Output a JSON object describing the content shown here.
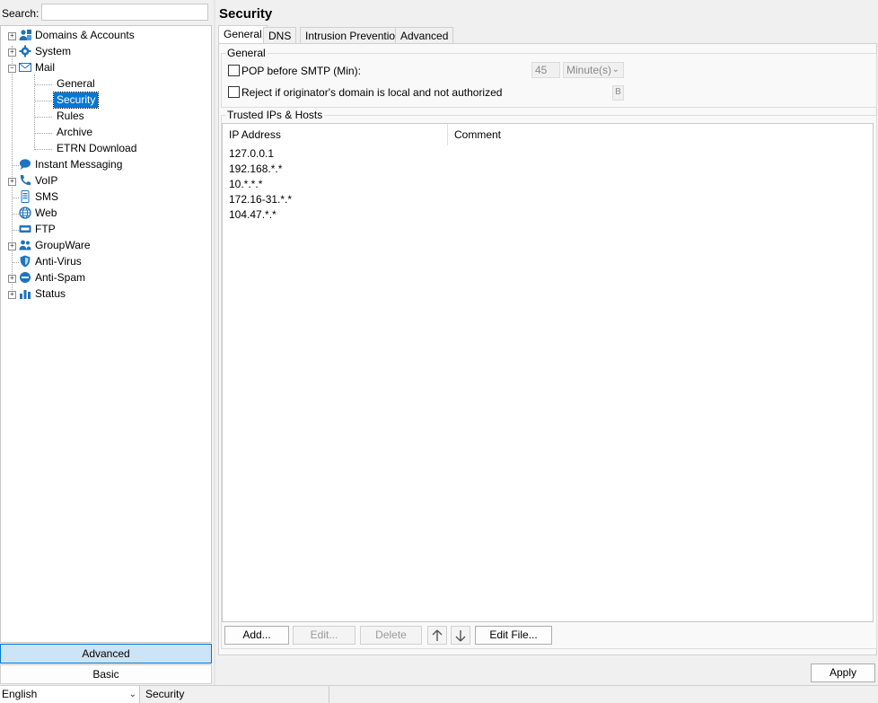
{
  "search": {
    "label": "Search:",
    "value": ""
  },
  "tree": {
    "items": [
      {
        "label": "Domains & Accounts",
        "icon": "users-icon"
      },
      {
        "label": "System",
        "icon": "gear-icon"
      },
      {
        "label": "Mail",
        "icon": "envelope-icon"
      },
      {
        "label": "General"
      },
      {
        "label": "Security"
      },
      {
        "label": "Rules"
      },
      {
        "label": "Archive"
      },
      {
        "label": "ETRN Download"
      },
      {
        "label": "Instant Messaging",
        "icon": "chat-bubble-icon"
      },
      {
        "label": "VoIP",
        "icon": "phone-icon"
      },
      {
        "label": "SMS",
        "icon": "sms-icon"
      },
      {
        "label": "Web",
        "icon": "globe-icon"
      },
      {
        "label": "FTP",
        "icon": "ftp-icon"
      },
      {
        "label": "GroupWare",
        "icon": "groupware-icon"
      },
      {
        "label": "Anti-Virus",
        "icon": "shield-icon"
      },
      {
        "label": "Anti-Spam",
        "icon": "no-entry-icon"
      },
      {
        "label": "Status",
        "icon": "bar-chart-icon"
      }
    ]
  },
  "mode_buttons": {
    "advanced": "Advanced",
    "basic": "Basic"
  },
  "page": {
    "title": "Security"
  },
  "tabs": [
    "General",
    "DNS",
    "Intrusion Prevention",
    "Advanced"
  ],
  "general_group": {
    "legend": "General",
    "pop_before_smtp": {
      "label": "POP before SMTP (Min):",
      "checked": false,
      "value": "45",
      "unit": "Minute(s)"
    },
    "reject_local": {
      "label": "Reject if originator's domain is local and not authorized",
      "checked": false,
      "indicator": "B"
    }
  },
  "trusted_group": {
    "legend": "Trusted IPs & Hosts",
    "columns": [
      "IP Address",
      "Comment"
    ],
    "rows": [
      "127.0.0.1",
      "192.168.*.*",
      "10.*.*.*",
      "172.16-31.*.*",
      "104.47.*.*"
    ]
  },
  "list_buttons": {
    "add": "Add...",
    "edit": "Edit...",
    "delete": "Delete",
    "edit_file": "Edit File..."
  },
  "apply": "Apply",
  "statusbar": {
    "language": "English",
    "text": "Security"
  },
  "colors": {
    "accent": "#0078d7",
    "selected_button_bg": "#cce4f7"
  }
}
